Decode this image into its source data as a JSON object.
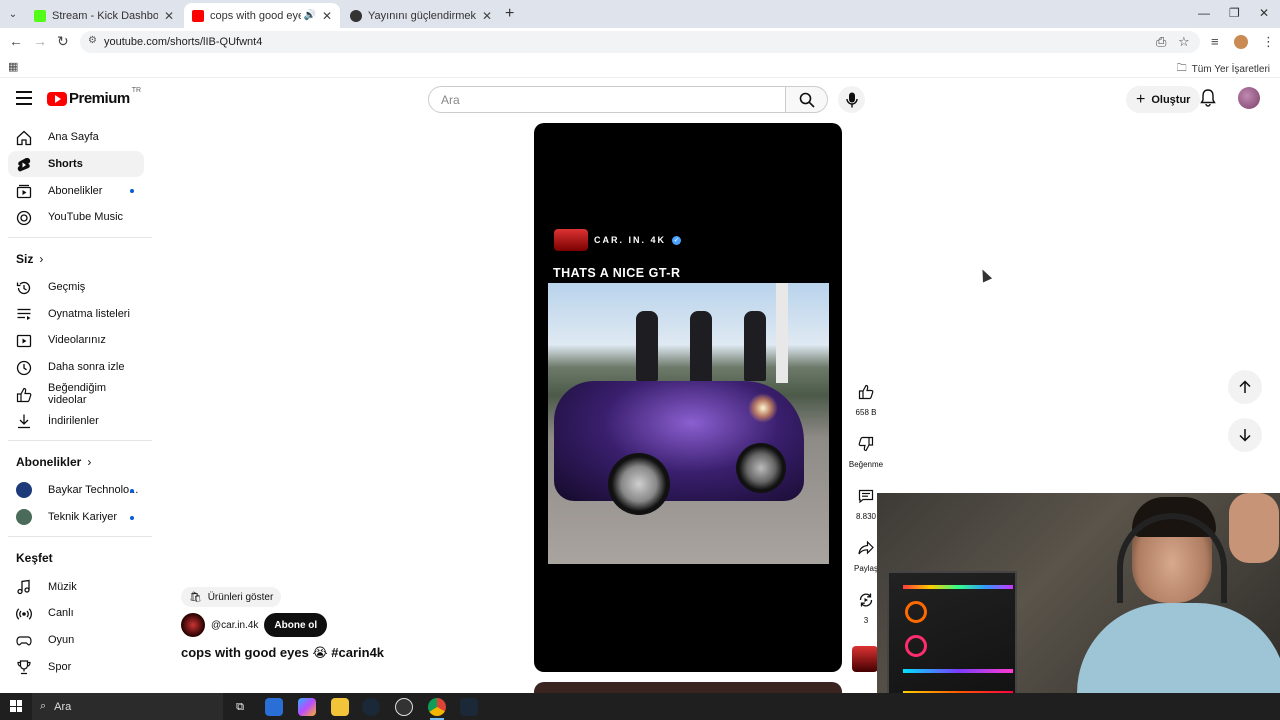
{
  "browser": {
    "tabs": [
      {
        "title": "Stream - Kick Dashboard",
        "active": false,
        "favicon_color": "#53fc18"
      },
      {
        "title": "cops with good eyes 😭 #c",
        "active": true,
        "favicon_color": "#ff0000"
      },
      {
        "title": "Yayınını güçlendirmek için en i",
        "active": false,
        "favicon_color": "#333333"
      }
    ],
    "url": "youtube.com/shorts/lIB-QUfwnt4",
    "bookmarks_label": "Tüm Yer İşaretleri"
  },
  "header": {
    "logo_text": "Premium",
    "country_code": "TR",
    "search_placeholder": "Ara",
    "create_label": "Oluştur"
  },
  "sidebar": {
    "main": [
      {
        "label": "Ana Sayfa",
        "icon": "home-icon",
        "active": false
      },
      {
        "label": "Shorts",
        "icon": "shorts-icon",
        "active": true
      },
      {
        "label": "Abonelikler",
        "icon": "subscriptions-icon",
        "active": false,
        "dot": true
      },
      {
        "label": "YouTube Music",
        "icon": "music-circle-icon",
        "active": false
      }
    ],
    "you_title": "Siz",
    "you": [
      {
        "label": "Geçmiş",
        "icon": "history-icon"
      },
      {
        "label": "Oynatma listeleri",
        "icon": "playlist-icon"
      },
      {
        "label": "Videolarınız",
        "icon": "your-videos-icon"
      },
      {
        "label": "Daha sonra izle",
        "icon": "clock-icon"
      },
      {
        "label": "Beğendiğim videolar",
        "icon": "thumbs-up-icon"
      },
      {
        "label": "İndirilenler",
        "icon": "download-icon"
      }
    ],
    "subs_title": "Abonelikler",
    "subs": [
      {
        "label": "Baykar Technolo...",
        "avatar_color": "#1d3a7a"
      },
      {
        "label": "Teknik Kariyer",
        "avatar_color": "#4a6a5a"
      }
    ],
    "explore_title": "Keşfet",
    "explore": [
      {
        "label": "Müzik",
        "icon": "music-note-icon"
      },
      {
        "label": "Canlı",
        "icon": "live-icon"
      },
      {
        "label": "Oyun",
        "icon": "gaming-icon"
      },
      {
        "label": "Spor",
        "icon": "trophy-icon"
      }
    ]
  },
  "short": {
    "channel_watermark": "CAR. IN. 4K",
    "headline": "THATS A NICE GT-R",
    "products_label": "Ürünleri göster",
    "handle": "@car.in.4k",
    "subscribe_label": "Abone ol",
    "title": "cops with good eyes 😭 #carin4k",
    "likes": "658 B",
    "dislike_label": "Beğenme",
    "comments": "8.830",
    "share_label": "Paylaş",
    "remix_count": "3"
  },
  "taskbar": {
    "search_label": "Ara"
  }
}
